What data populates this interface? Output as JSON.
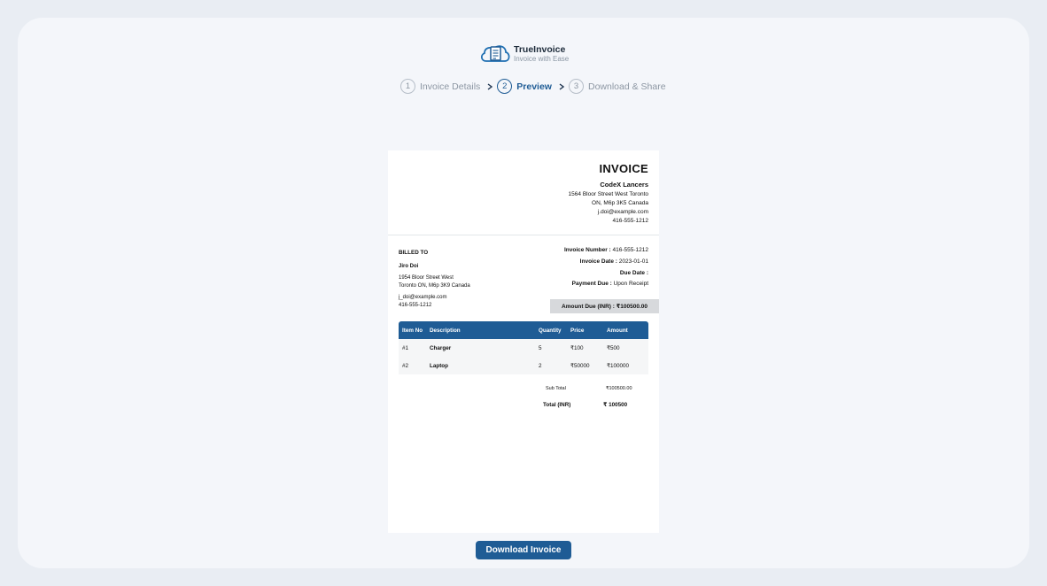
{
  "brand": {
    "name": "TrueInvoice",
    "tagline": "Invoice with Ease"
  },
  "steps": [
    {
      "num": "1",
      "label": "Invoice Details",
      "active": false
    },
    {
      "num": "2",
      "label": "Preview",
      "active": true
    },
    {
      "num": "3",
      "label": "Download & Share",
      "active": false
    }
  ],
  "invoice": {
    "title": "INVOICE",
    "company": {
      "name": "CodeX Lancers",
      "address1": "1564 Bloor Street West Toronto",
      "address2": "ON, M6p 3K5 Canada",
      "email": "j.doi@example.com",
      "phone": "416-555-1212"
    },
    "billed_to": {
      "heading": "BILLED TO",
      "name": "Jiro Doi",
      "address1": "1954 Bloor Street West",
      "address2": "Toronto ON, M6p 3K9 Canada",
      "email": "j_doi@example.com",
      "phone": "416-555-1212"
    },
    "meta": {
      "number_label": "Invoice Number :",
      "number_value": "416-555-1212",
      "date_label": "Invoice Date :",
      "date_value": "2023-01-01",
      "due_label": "Due Date :",
      "due_value": "",
      "payment_label": "Payment Due :",
      "payment_value": "Upon Receipt"
    },
    "amount_due": "Amount Due (INR) : ₹100500.00",
    "table": {
      "headers": [
        "Item No",
        "Description",
        "Quantity",
        "Price",
        "Amount"
      ],
      "rows": [
        [
          "#1",
          "Charger",
          "5",
          "₹100",
          "₹500"
        ],
        [
          "#2",
          "Laptop",
          "2",
          "₹50000",
          "₹100000"
        ]
      ]
    },
    "subtotal_label": "Sub Total",
    "subtotal_value": "₹100500.00",
    "total_label": "Total (INR)",
    "total_value": "₹ 100500"
  },
  "download_label": "Download Invoice",
  "colors": {
    "primary": "#1f5c95",
    "background": "#f4f6fa"
  }
}
